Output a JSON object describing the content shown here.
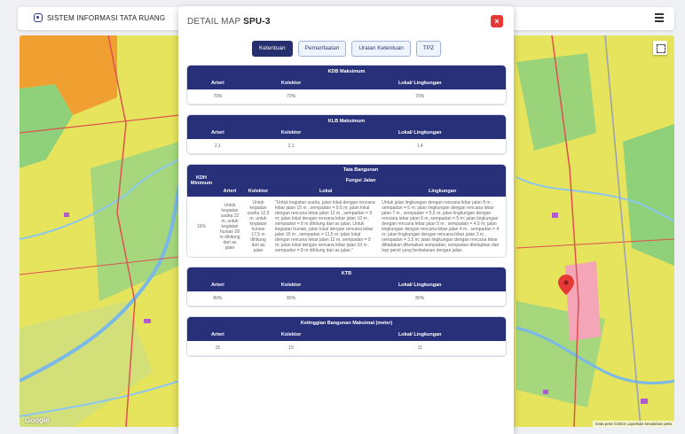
{
  "navbar": {
    "title": "SISTEM INFORMASI TATA RUANG"
  },
  "map": {
    "google": "Google",
    "attribution": "Data peta ©2024  Laporkan kesalahan peta"
  },
  "modal": {
    "title_prefix": "DETAIL MAP ",
    "title_code": "SPU-3",
    "close": "×",
    "tabs": [
      "Ketentuan",
      "Pemanfaatan",
      "Uraian Ketentuan",
      "TPZ"
    ],
    "active_tab": "Ketentuan"
  },
  "kdb": {
    "title": "KDB Maksimum",
    "headers": [
      "Arteri",
      "Kolektor",
      "Lokal/ Lingkungan"
    ],
    "values": [
      "70%",
      "70%",
      "70%"
    ]
  },
  "klb": {
    "title": "KLB Maksimum",
    "headers": [
      "Arteri",
      "Kolektor",
      "Lokal/ Lingkungan"
    ],
    "values": [
      "2,1",
      "2,1",
      "1,4"
    ]
  },
  "tata_bangunan": {
    "title": "Tata Bangunan",
    "kdh_header": "KDH Minimum",
    "fungsi_header": "Fungsi Jalan",
    "headers": [
      "Arteri",
      "Kolektor",
      "Lokal",
      "Lingkungan"
    ],
    "kdh_value": "16%",
    "arteri": "Untuk kegiatan usaha 22 m, untuk kegiatan hunian 28 m dihitung dari as jalan",
    "kolektor": "Untuk kegiatan usaha 12,5 m, untuk kegiatan hunian 17,5 m dihitung dari as jalan",
    "lokal": "\"Untuk kegiatan usaha, jalan lokal dengan rencana lebar jalan 15 m , sempadan = 9,5 m; jalan lokal dengan rencana lebar jalan 12 m , sempadan = 9 m; jalan lokal dengan rencana lebar jalan 10 m , sempadan = 8 m dihitung dari as jalan. Untuk kegiatan hunian, jalan lokal dengan rencana lebar jalan 15 m , sempadan = 11,5 m; jalan lokal dengan rencana lebar jalan 12 m, sempadan = 9 m; jalan lokal dengan rencana lebar jalan 10 m , sempadan = 8 m dihitung dari as jalan.\"",
    "lingkungan": "Untuk jalan lingkungan dengan rencana lebar jalan 8 m , sempadan = 6 m; jalan lingkungan dengan rencana lebar jalan 7 m , sempadan = 5,5 m; jalan lingkungan dengan rencana lebar jalan 6 m, sempadan = 5 m; jalan lingkungan dengan rencana lebar jalan 5 m , sempadan = 4,5 m; jalan lingkungan dengan rencana lebar jalan 4 m , sempadan = 4 m; jalan lingkungan dengan rencana lebar jalan 3 m , sempadan = 3,5 m; jalan lingkungan dengan rencana lebar ditiadakan dikenakan sempadan; sempadan ditetapkan dari tepi persil yang berbatasan dengan jalan."
  },
  "ktb": {
    "title": "KTB",
    "headers": [
      "Arteri",
      "Kolektor",
      "Lokal/ Lingkungan"
    ],
    "values": [
      "80%",
      "80%",
      "80%"
    ]
  },
  "ketinggian": {
    "title": "Ketinggian Bangunan Maksimal (meter)",
    "headers": [
      "Arteri",
      "Kolektor",
      "Lokal/ Lingkungan"
    ],
    "values": [
      "15",
      "15",
      "11"
    ]
  },
  "colors": {
    "primary": "#28307a",
    "close": "#e53935",
    "map_yellow": "#e8e55a",
    "map_orange": "#f0a030",
    "map_green": "#7ec87a",
    "marker": "#e53935"
  }
}
